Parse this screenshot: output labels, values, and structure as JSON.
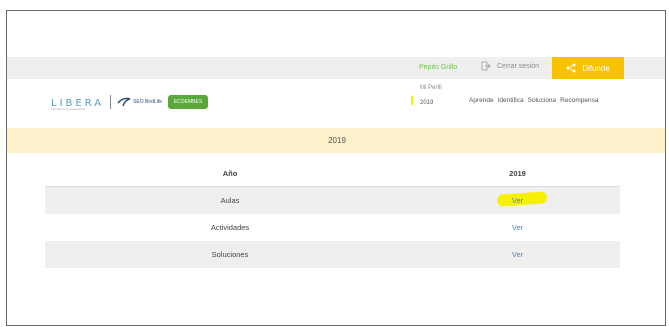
{
  "topbar": {
    "user_name": "Pepito Grillo",
    "logout_label": "Cerrar sesión",
    "share_label": "Difunde"
  },
  "dropdown": {
    "items": [
      "Mi Perfil",
      "2019"
    ]
  },
  "brand": {
    "logo_text": "LIBERA",
    "logo_subtitle": "naturaleza sin basuraleza",
    "partner_seo": "SEO BirdLife",
    "partner_eco": "ECOEMBES"
  },
  "nav": {
    "items": [
      "Aprende",
      "Identifica",
      "Soluciona",
      "Recompensa"
    ]
  },
  "band": {
    "title": "2019"
  },
  "table": {
    "headers": [
      "Año",
      "2019"
    ],
    "rows": [
      {
        "label": "Aulas",
        "link": "Ver"
      },
      {
        "label": "Actividades",
        "link": "Ver"
      },
      {
        "label": "Soluciones",
        "link": "Ver"
      }
    ]
  },
  "colors": {
    "accent_yellow": "#f8c200",
    "band": "#fdf1cc",
    "highlight": "#f5f100",
    "link": "#4a86c5",
    "user_green": "#6cc24a"
  }
}
